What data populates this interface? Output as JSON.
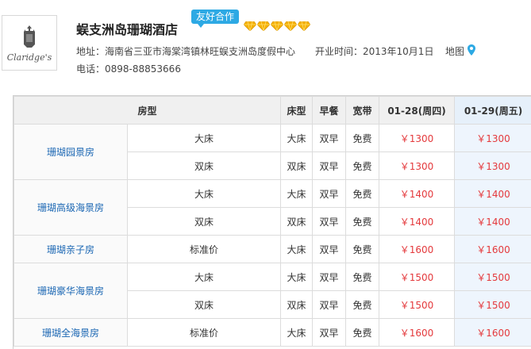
{
  "hotel": {
    "name": "蜈支洲岛珊瑚酒店",
    "partner_badge": "友好合作",
    "diamond_count": 5,
    "logo_text": "Claridge's",
    "address": "地址：海南省三亚市海棠湾镇林旺蜈支洲岛度假中心",
    "opened": "开业时间：2013年10月1日",
    "map_label": "地图",
    "phone": "电话：0898-88853666"
  },
  "colors": {
    "accent_blue": "#2da9e4",
    "price_red": "#e4393c",
    "link_blue": "#1a66b3",
    "highlight_col": "#eef5fd"
  },
  "table": {
    "headers": {
      "room_type": "房型",
      "bed": "床型",
      "breakfast": "早餐",
      "broadband": "宽带",
      "date1": "01-28(周四)",
      "date2": "01-29(周五)"
    },
    "rooms": [
      {
        "name": "珊瑚园景房",
        "rows": [
          {
            "subtype": "大床",
            "bed": "大床",
            "breakfast": "双早",
            "broadband": "免费",
            "price1": "￥1300",
            "price2": "￥1300"
          },
          {
            "subtype": "双床",
            "bed": "双床",
            "breakfast": "双早",
            "broadband": "免费",
            "price1": "￥1300",
            "price2": "￥1300"
          }
        ]
      },
      {
        "name": "珊瑚高级海景房",
        "rows": [
          {
            "subtype": "大床",
            "bed": "大床",
            "breakfast": "双早",
            "broadband": "免费",
            "price1": "￥1400",
            "price2": "￥1400"
          },
          {
            "subtype": "双床",
            "bed": "双床",
            "breakfast": "双早",
            "broadband": "免费",
            "price1": "￥1400",
            "price2": "￥1400"
          }
        ]
      },
      {
        "name": "珊瑚亲子房",
        "rows": [
          {
            "subtype": "标准价",
            "bed": "大床",
            "breakfast": "双早",
            "broadband": "免费",
            "price1": "￥1600",
            "price2": "￥1600"
          }
        ]
      },
      {
        "name": "珊瑚豪华海景房",
        "rows": [
          {
            "subtype": "大床",
            "bed": "大床",
            "breakfast": "双早",
            "broadband": "免费",
            "price1": "￥1500",
            "price2": "￥1500"
          },
          {
            "subtype": "双床",
            "bed": "双床",
            "breakfast": "双早",
            "broadband": "免费",
            "price1": "￥1500",
            "price2": "￥1500"
          }
        ]
      },
      {
        "name": "珊瑚全海景房",
        "rows": [
          {
            "subtype": "标准价",
            "bed": "大床",
            "breakfast": "双早",
            "broadband": "免费",
            "price1": "￥1600",
            "price2": "￥1600"
          }
        ]
      }
    ]
  }
}
